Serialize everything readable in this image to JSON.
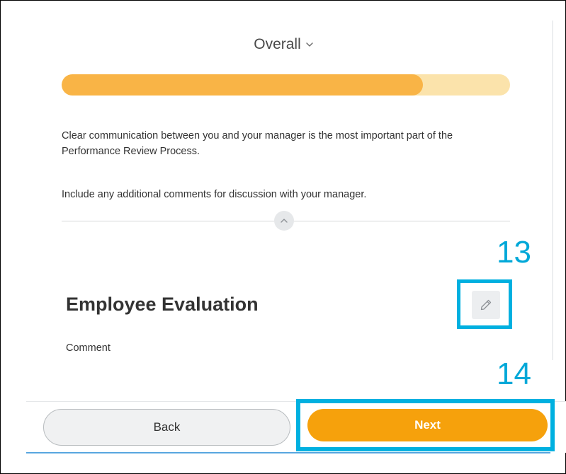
{
  "section": {
    "title": "Overall",
    "toggle_icon": "chevron-down-icon"
  },
  "progress": {
    "fraction": 0.805,
    "fill_color": "#f9b446",
    "track_color": "#fbe3ab"
  },
  "instructions": {
    "paragraph_1": "Clear communication between you and your manager is the most important part of the Performance Review Process.",
    "paragraph_2": "Include any additional comments for discussion with your manager."
  },
  "collapse": {
    "icon": "chevron-up-icon"
  },
  "callouts": {
    "edit": "13",
    "next": "14",
    "color": "#00b0e0"
  },
  "evaluation": {
    "title": "Employee Evaluation",
    "edit_icon": "pencil-icon",
    "comment_label": "Comment"
  },
  "footer": {
    "back_label": "Back",
    "next_label": "Next",
    "next_color": "#f6a10c"
  }
}
